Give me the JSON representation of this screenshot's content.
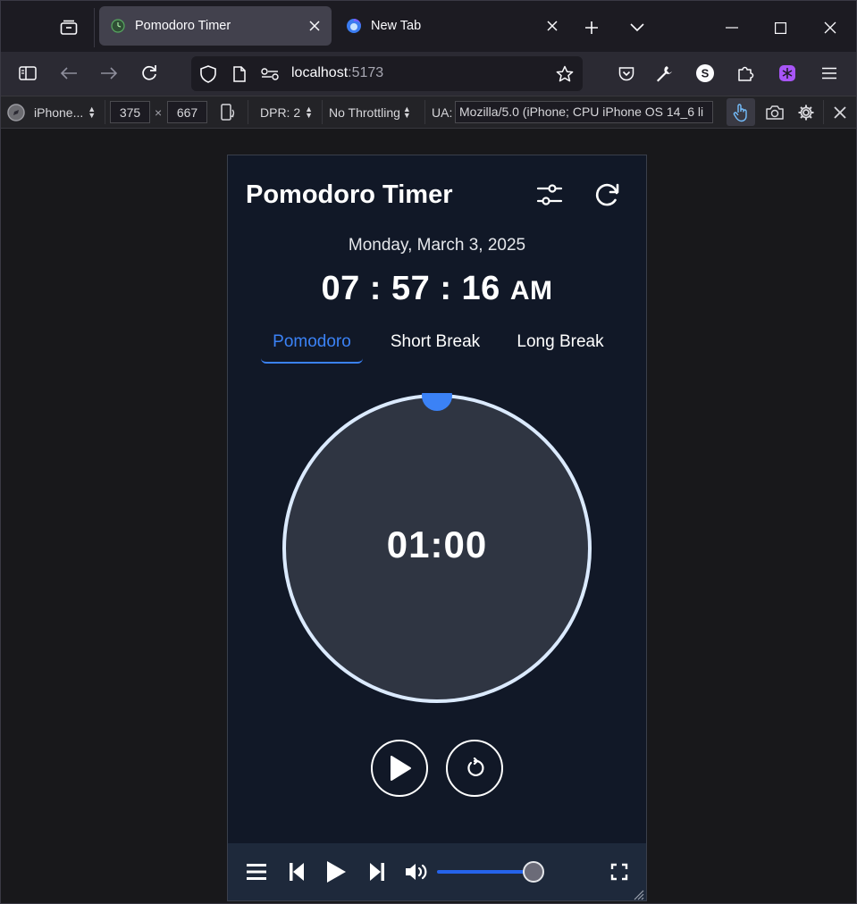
{
  "browser": {
    "tabs": [
      {
        "title": "Pomodoro Timer",
        "active": true
      },
      {
        "title": "New Tab",
        "active": false
      }
    ],
    "url": {
      "host": "localhost",
      "port": ":5173"
    }
  },
  "rdm": {
    "device": "iPhone...",
    "width": "375",
    "times": "×",
    "height": "667",
    "dpr": "DPR: 2",
    "throttling": "No Throttling",
    "ua_label": "UA:",
    "ua_value": "Mozilla/5.0 (iPhone; CPU iPhone OS 14_6 li"
  },
  "app": {
    "title": "Pomodoro Timer",
    "date": "Monday, March 3, 2025",
    "time": "07 : 57 : 16",
    "ampm": "AM",
    "modes": [
      "Pomodoro",
      "Short Break",
      "Long Break"
    ],
    "active_mode": "Pomodoro",
    "timer": "01:00",
    "progress": 0,
    "volume": 1.0
  },
  "colors": {
    "accent": "#3b82f6",
    "ring": "#dbeafe",
    "ring_fill": "#2f3542",
    "bg": "#111827",
    "player_bg": "#1e293b"
  }
}
